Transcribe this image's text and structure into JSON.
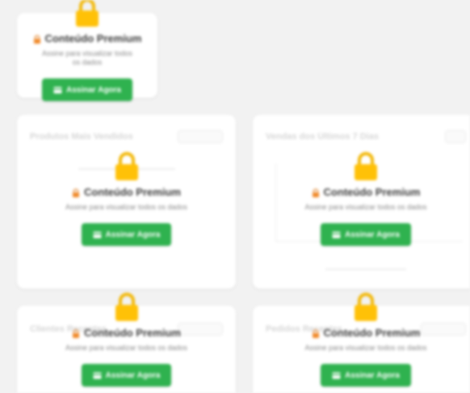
{
  "premium": {
    "lock_label": "🔒",
    "title": "Conteúdo Premium",
    "description": "Assine para visualizar todos os dados",
    "description_narrow_line1": "Assine para visualizar todos",
    "description_narrow_line2": "os dados",
    "button_label": "Assinar Agora"
  },
  "cards": {
    "top_small": {
      "faint_title": ""
    },
    "mid_left": {
      "faint_title": "Produtos Mais Vendidos"
    },
    "mid_right": {
      "faint_title": "Vendas dos Últimos 7 Dias"
    },
    "bot_left": {
      "faint_title": "Clientes Recentes"
    },
    "bot_right": {
      "faint_title": "Pedidos Recentes"
    }
  },
  "colors": {
    "accent_green": "#2fb24f",
    "lock_yellow": "#ffc107",
    "lock_shackle": "#f2b705",
    "background": "#f2f2f2"
  }
}
